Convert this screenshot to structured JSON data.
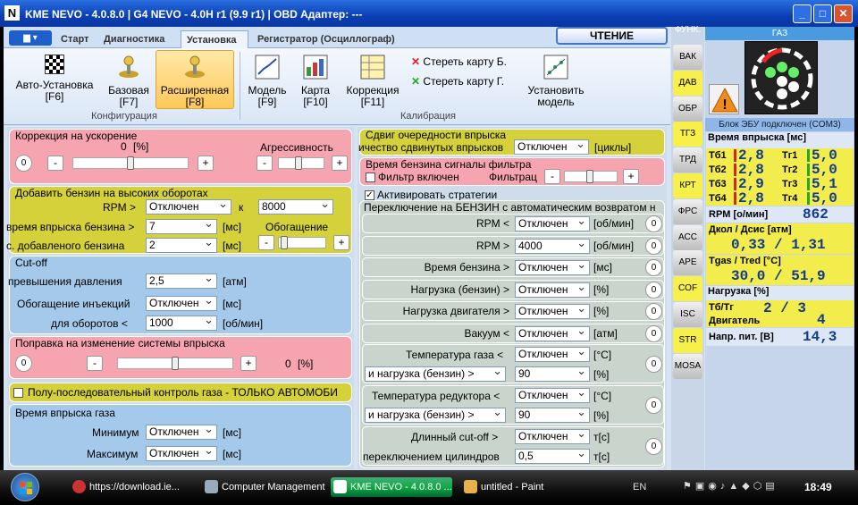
{
  "window": {
    "title": "KME NEVO - 4.0.8.0 | G4 NEVO - 4.0H r1 (9.9 r1) | OBD Адаптер: ---",
    "logo": "N",
    "min": "_",
    "max": "□",
    "close": "✕"
  },
  "tabs": [
    "Старт",
    "Диагностика",
    "Установка",
    "Регистратор (Осциллограф)"
  ],
  "read_button": "ЧТЕНИЕ",
  "ribbon": {
    "buttons": [
      {
        "label1": "Авто-Установка",
        "label2": "[F6]"
      },
      {
        "label1": "Базовая",
        "label2": "[F7]"
      },
      {
        "label1": "Расширенная",
        "label2": "[F8]"
      },
      {
        "label1": "Модель",
        "label2": "[F9]"
      },
      {
        "label1": "Карта",
        "label2": "[F10]"
      },
      {
        "label1": "Коррекция",
        "label2": "[F11]"
      },
      {
        "label1": "Установить",
        "label2": "модель"
      }
    ],
    "erase_b": "Стереть карту Б.",
    "erase_g": "Стереть карту Г.",
    "group_config": "Конфигурация",
    "group_calib": "Калибрация"
  },
  "left": {
    "accel": {
      "title": "Коррекция на ускорение",
      "value": "0",
      "unit": "[%]",
      "aggr": "Агрессивность",
      "circ": "0",
      "minus": "-",
      "plus": "+"
    },
    "highrpm": {
      "title": "Добавить бензин на высоких оборотах",
      "rpm_lbl": "RPM >",
      "rpm_val": "Отключен",
      "k": "к",
      "k_val": "8000",
      "time_lbl": "время впрыска бензина >",
      "time_val": "7",
      "time_unit": "[мс]",
      "enrich": "Обогащение",
      "added_lbl": "с. добавленого бензина",
      "added_val": "2",
      "added_unit": "[мс]",
      "minus": "-",
      "plus": "+"
    },
    "cutoff": {
      "title": "Cut-off",
      "pressure_lbl": "превышения давления",
      "pressure_val": "2,5",
      "pressure_unit": "[атм]",
      "inj_lbl": "Обогащение инъекций",
      "inj_val": "Отключен",
      "inj_unit": "[мс]",
      "rpm_lbl": "для оборотов <",
      "rpm_val": "1000",
      "rpm_unit": "[об/мин]"
    },
    "injchange": {
      "title": "Поправка на изменение системы впрыска",
      "circ": "0",
      "minus": "-",
      "plus": "+",
      "value": "0",
      "unit": "[%]"
    },
    "semiseq": {
      "label": "Полу-последовательный контроль газа - ТОЛЬКО АВТОМОБИ"
    },
    "injtime": {
      "title": "Время впрыска газа",
      "min_lbl": "Минимум",
      "min_val": "Отключен",
      "min_unit": "[мс]",
      "max_lbl": "Максимум",
      "max_val": "Отключен",
      "max_unit": "[мс]"
    }
  },
  "mid": {
    "shift": {
      "title": "Сдвиг очередности впрыска",
      "lbl": "ичество сдвинутых впрысков",
      "val": "Отключен",
      "unit": "[циклы]"
    },
    "filter": {
      "title": "Время бензина сигналы фильтра",
      "chk_lbl": "Фильтр включен",
      "filt_lbl": "Фильтрац",
      "minus": "-",
      "plus": "+"
    },
    "strategy": {
      "chk_lbl": "Активировать стратегии",
      "title": "Переключение на БЕНЗИН с автоматическим возвратом н"
    },
    "rows": [
      {
        "lbl": "RPM <",
        "val": "Отключен",
        "unit": "[об/мин]",
        "circ": "0"
      },
      {
        "lbl": "RPM >",
        "val": "4000",
        "unit": "[об/мин]",
        "circ": "0"
      },
      {
        "lbl": "Время бензина >",
        "val": "Отключен",
        "unit": "[мс]",
        "circ": "0"
      },
      {
        "lbl": "Нагрузка (бензин) >",
        "val": "Отключен",
        "unit": "[%]",
        "circ": "0"
      },
      {
        "lbl": "Нагрузка двигателя >",
        "val": "Отключен",
        "unit": "[%]",
        "circ": "0"
      },
      {
        "lbl": "Вакуум <",
        "val": "Отключен",
        "unit": "[атм]",
        "circ": "0"
      }
    ],
    "gas_temp": {
      "lbl": "Температура газа <",
      "val": "Отключен",
      "unit": "[°C]",
      "load_lbl": "и нагрузка (бензин) >",
      "load_val": "90",
      "load_unit": "[%]",
      "circ": "0"
    },
    "red_temp": {
      "lbl": "Температура редуктора <",
      "val": "Отключен",
      "unit": "[°C]",
      "load_lbl": "и нагрузка (бензин) >",
      "load_val": "90",
      "load_unit": "[%]",
      "circ": "0"
    },
    "long_cut": {
      "lbl": "Длинный cut-off >",
      "val": "Отключен",
      "unit": "т[с]",
      "lbl2": "переключением цилиндров",
      "val2": "0,5",
      "unit2": "т[с]",
      "circ": "0"
    }
  },
  "side": [
    "ФУНК.",
    "ВАК",
    "ДАВ",
    "ОБР",
    "ТГЗ",
    "ТРД",
    "КРТ",
    "ФРС",
    "АСС",
    "АРЕ",
    "COF",
    "ISC",
    "STR",
    "MOSA"
  ],
  "right": {
    "gas_header": "ГАЗ",
    "ecu": "Блок ЭБУ подключен (COM3)",
    "inj_title": "Время впрыска [мс]",
    "tb": [
      {
        "n": "Тб1",
        "v": "2,8"
      },
      {
        "n": "Тб2",
        "v": "2,8"
      },
      {
        "n": "Тб3",
        "v": "2,9"
      },
      {
        "n": "Тб4",
        "v": "2,8"
      }
    ],
    "tr": [
      {
        "n": "Тг1",
        "v": "5,0"
      },
      {
        "n": "Тг2",
        "v": "5,0"
      },
      {
        "n": "Тг3",
        "v": "5,1"
      },
      {
        "n": "Тг4",
        "v": "5,0"
      }
    ],
    "rpm_lbl": "RPM [о/мин]",
    "rpm_val": "862",
    "press_lbl": "Дкол / Дсис [атм]",
    "press_val": "0,33 / 1,31",
    "temp_lbl": "Tgas / Tred [°C]",
    "temp_val": "30,0 / 51,9",
    "load_title": "Нагрузка [%]",
    "load_lbl": "Тб/Тг",
    "load_val": "2 / 3",
    "eng_lbl": "Двигатель",
    "eng_val": "4",
    "volt_lbl": "Напр. пит. [В]",
    "volt_val": "14,3"
  },
  "taskbar": {
    "items": [
      "https://download.ie...",
      "Computer Management",
      "KME NEVO - 4.0.8.0 ...",
      "untitled - Paint"
    ],
    "lang": "EN",
    "time": "18:49"
  }
}
